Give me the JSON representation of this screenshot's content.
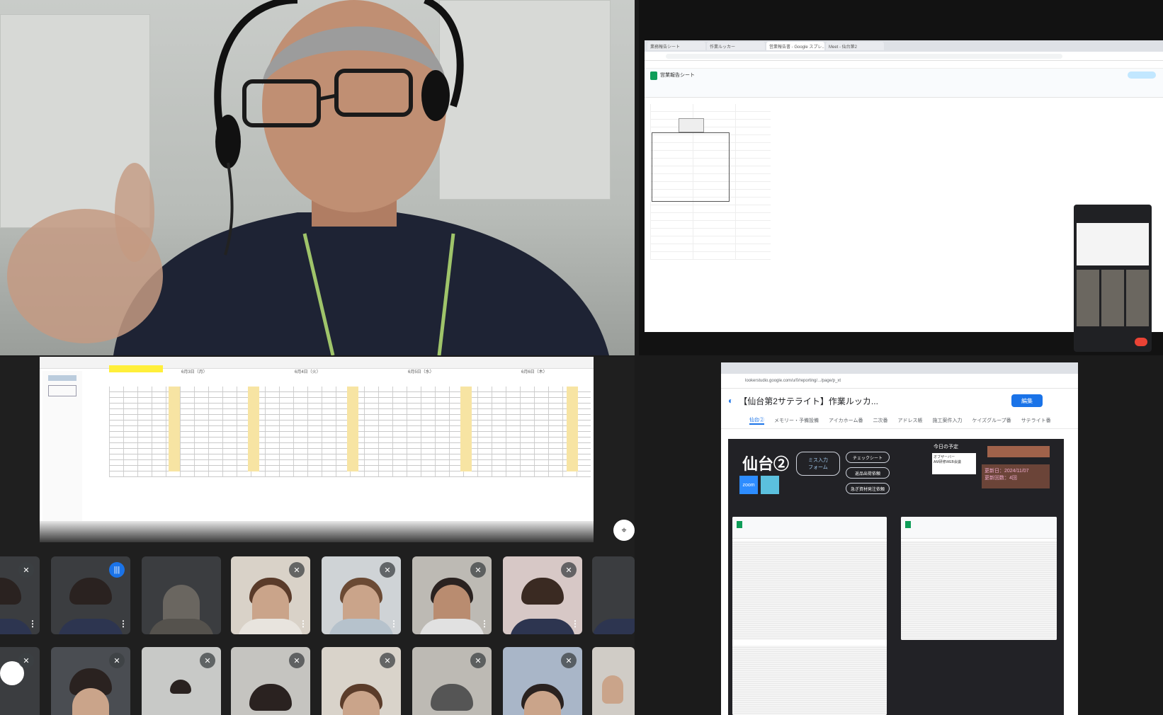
{
  "colors": {
    "meet_bg": "#1b1b1b",
    "ls_blue": "#1a73e8",
    "sheet_yellow": "#f7e4a3",
    "zoom_blue": "#2d8cff",
    "end_call_red": "#ea4335"
  },
  "top_right_share": {
    "browser_tabs": [
      "業務報告シート",
      "作業ルッカー",
      "営業報告書 - Google スプレ...",
      "Meet - 仙台第2"
    ],
    "sheet_title": "営業報告シート"
  },
  "bottom_left_share": {
    "sheet_col_groups": [
      "6月3日（月）",
      "6月4日（火）",
      "6月5日（水）",
      "6月6日（木）"
    ]
  },
  "participants_tiles": [
    {
      "icon": "mic-off-icon"
    },
    {
      "icon": "speaking-icon"
    },
    {
      "icon": ""
    },
    {
      "icon": "mic-off-icon"
    },
    {
      "icon": "mic-off-icon"
    },
    {
      "icon": "mic-off-icon"
    },
    {
      "icon": "mic-off-icon"
    },
    {
      "icon": "mic-off-icon"
    },
    {
      "icon": "mic-off-icon"
    },
    {
      "icon": "mic-off-icon"
    },
    {
      "icon": "mic-off-icon"
    },
    {
      "icon": "mic-off-icon"
    },
    {
      "icon": "mic-off-icon"
    },
    {
      "icon": "mic-off-icon"
    }
  ],
  "looker_studio": {
    "report_title": "【仙台第2サテライト】作業ルッカ...",
    "edit_label": "編集",
    "tabs": [
      "仙台②",
      "メモリー・予備設備",
      "アイカホーム番",
      "二次番",
      "アドレス帳",
      "施工案件入力",
      "ケイズグループ番",
      "サテライト番"
    ],
    "canvas": {
      "site_name": "仙台②",
      "btn_form": "ミス入力\nフォーム",
      "btn_check": "チェックシート",
      "btn_alert": "返品出荷依頼",
      "btn_material": "急ぎ資材発注依頼",
      "today_label": "今日の予定",
      "today_items": [
        "オブザーバー",
        "AM研修WEB会議"
      ],
      "updated": "更新日：2024/11/07",
      "update_count": "更新回数：4回",
      "zoom_label": "zoom"
    }
  }
}
